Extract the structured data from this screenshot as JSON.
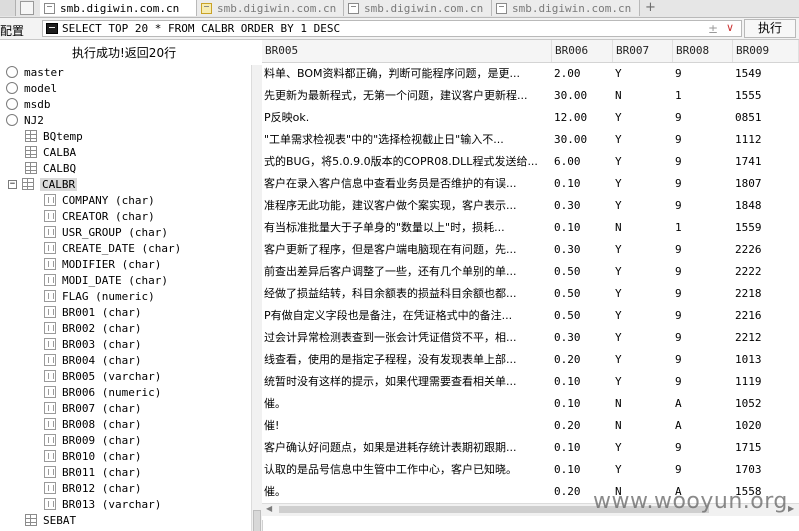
{
  "tabs": [
    {
      "label": "smb.digiwin.com.cn"
    },
    {
      "label": "smb.digiwin.com.cn"
    },
    {
      "label": "smb.digiwin.com.cn"
    },
    {
      "label": "smb.digiwin.com.cn"
    }
  ],
  "toolbar": {
    "config_label": "配置",
    "query": "SELECT TOP 20 * FROM CALBR ORDER BY 1 DESC",
    "run_label": "执行",
    "plus_minus_icon": "±",
    "dropdown_icon": "∨"
  },
  "status": "执行成功!返回20行",
  "tree": {
    "databases": [
      "master",
      "model",
      "msdb",
      "NJ2"
    ],
    "tables": [
      "BQtemp",
      "CALBA",
      "CALBQ",
      "CALBR"
    ],
    "columns": [
      "COMPANY (char)",
      "CREATOR (char)",
      "USR_GROUP (char)",
      "CREATE_DATE (char)",
      "MODIFIER (char)",
      "MODI_DATE (char)",
      "FLAG (numeric)",
      "BR001 (char)",
      "BR002 (char)",
      "BR003 (char)",
      "BR004 (char)",
      "BR005 (varchar)",
      "BR006 (numeric)",
      "BR007 (char)",
      "BR008 (char)",
      "BR009 (char)",
      "BR010 (char)",
      "BR011 (char)",
      "BR012 (char)",
      "BR013 (varchar)",
      "SEBAT"
    ]
  },
  "grid": {
    "headers": [
      "BR005",
      "BR006",
      "BR007",
      "BR008",
      "BR009"
    ],
    "rows": [
      [
        "料单、BOM资料都正确，判断可能程序问题，是更...",
        "2.00",
        "Y",
        "9",
        "1549"
      ],
      [
        "先更新为最新程式，无第一个问题，建议客户更新程...",
        "30.00",
        "N",
        "1",
        "1555"
      ],
      [
        "P反映ok.",
        "12.00",
        "Y",
        "9",
        "0851"
      ],
      [
        "\"工单需求检视表\"中的\"选择检视截止日\"输入不...",
        "30.00",
        "Y",
        "9",
        "1112"
      ],
      [
        "式的BUG，将5.0.9.0版本的COPR08.DLL程式发送给...",
        "6.00",
        "Y",
        "9",
        "1741"
      ],
      [
        "客户在录入客户信息中查看业务员是否维护的有误...",
        "0.10",
        "Y",
        "9",
        "1807"
      ],
      [
        "准程序无此功能，建议客户做个案实现，客户表示...",
        "0.30",
        "Y",
        "9",
        "1848"
      ],
      [
        "有当标准批量大于子单身的\"数量以上\"时，损耗...",
        "0.10",
        "N",
        "1",
        "1559"
      ],
      [
        "客户更新了程序，但是客户端电脑现在有问题，先...",
        "0.30",
        "Y",
        "9",
        "2226"
      ],
      [
        "前查出差异后客户调整了一些，还有几个单别的单...",
        "0.50",
        "Y",
        "9",
        "2222"
      ],
      [
        "经做了损益结转，科目余额表的损益科目余额也都...",
        "0.50",
        "Y",
        "9",
        "2218"
      ],
      [
        "P有做自定义字段也是备注，在凭证格式中的备注...",
        "0.50",
        "Y",
        "9",
        "2216"
      ],
      [
        "过会计异常检测表查到一张会计凭证借贷不平，相...",
        "0.30",
        "Y",
        "9",
        "2212"
      ],
      [
        "线查看，使用的是指定子程程，没有发现表单上部...",
        "0.20",
        "Y",
        "9",
        "1013"
      ],
      [
        "统暂时没有这样的提示，如果代理需要查看相关单...",
        "0.10",
        "Y",
        "9",
        "1119"
      ],
      [
        "催。",
        "0.10",
        "N",
        "A",
        "1052"
      ],
      [
        "催!",
        "0.20",
        "N",
        "A",
        "1020"
      ],
      [
        "客户确认好问题点，如果是进耗存统计表期初跟期...",
        "0.10",
        "Y",
        "9",
        "1715"
      ],
      [
        "认取的是品号信息中生管中工作中心，客户已知晓。",
        "0.10",
        "Y",
        "9",
        "1703"
      ],
      [
        "催。",
        "0.20",
        "N",
        "A",
        "1558"
      ]
    ]
  },
  "watermark": "www.wooyun.org"
}
